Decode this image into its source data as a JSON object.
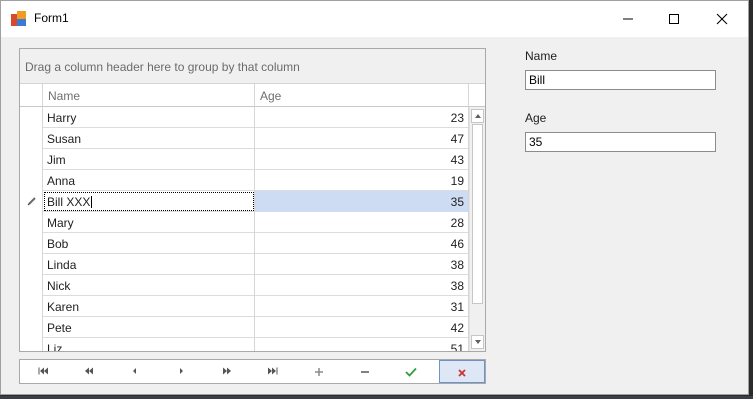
{
  "window": {
    "title": "Form1"
  },
  "grid": {
    "group_panel_text": "Drag a column header here to group by that column",
    "columns": [
      "Name",
      "Age"
    ],
    "rows": [
      {
        "name": "Harry",
        "age": "23"
      },
      {
        "name": "Susan",
        "age": "47"
      },
      {
        "name": "Jim",
        "age": "43"
      },
      {
        "name": "Anna",
        "age": "19"
      },
      {
        "name": "Bill XXX",
        "age": "35",
        "editing": true
      },
      {
        "name": "Mary",
        "age": "28"
      },
      {
        "name": "Bob",
        "age": "46"
      },
      {
        "name": "Linda",
        "age": "38"
      },
      {
        "name": "Nick",
        "age": "38"
      },
      {
        "name": "Karen",
        "age": "31"
      },
      {
        "name": "Pete",
        "age": "42"
      },
      {
        "name": "Liz",
        "age": "51"
      }
    ]
  },
  "navigator": {
    "buttons": [
      "first-icon",
      "prev-page-icon",
      "prev-icon",
      "next-icon",
      "next-page-icon",
      "last-icon",
      "append-icon",
      "remove-icon",
      "end-edit-icon",
      "cancel-edit-icon"
    ]
  },
  "form": {
    "name_label": "Name",
    "name_value": "Bill",
    "age_label": "Age",
    "age_value": "35"
  },
  "colors": {
    "focused_cell": "#cddcf3",
    "end_edit": "#2e9e3e",
    "cancel_edit": "#d0312d"
  }
}
